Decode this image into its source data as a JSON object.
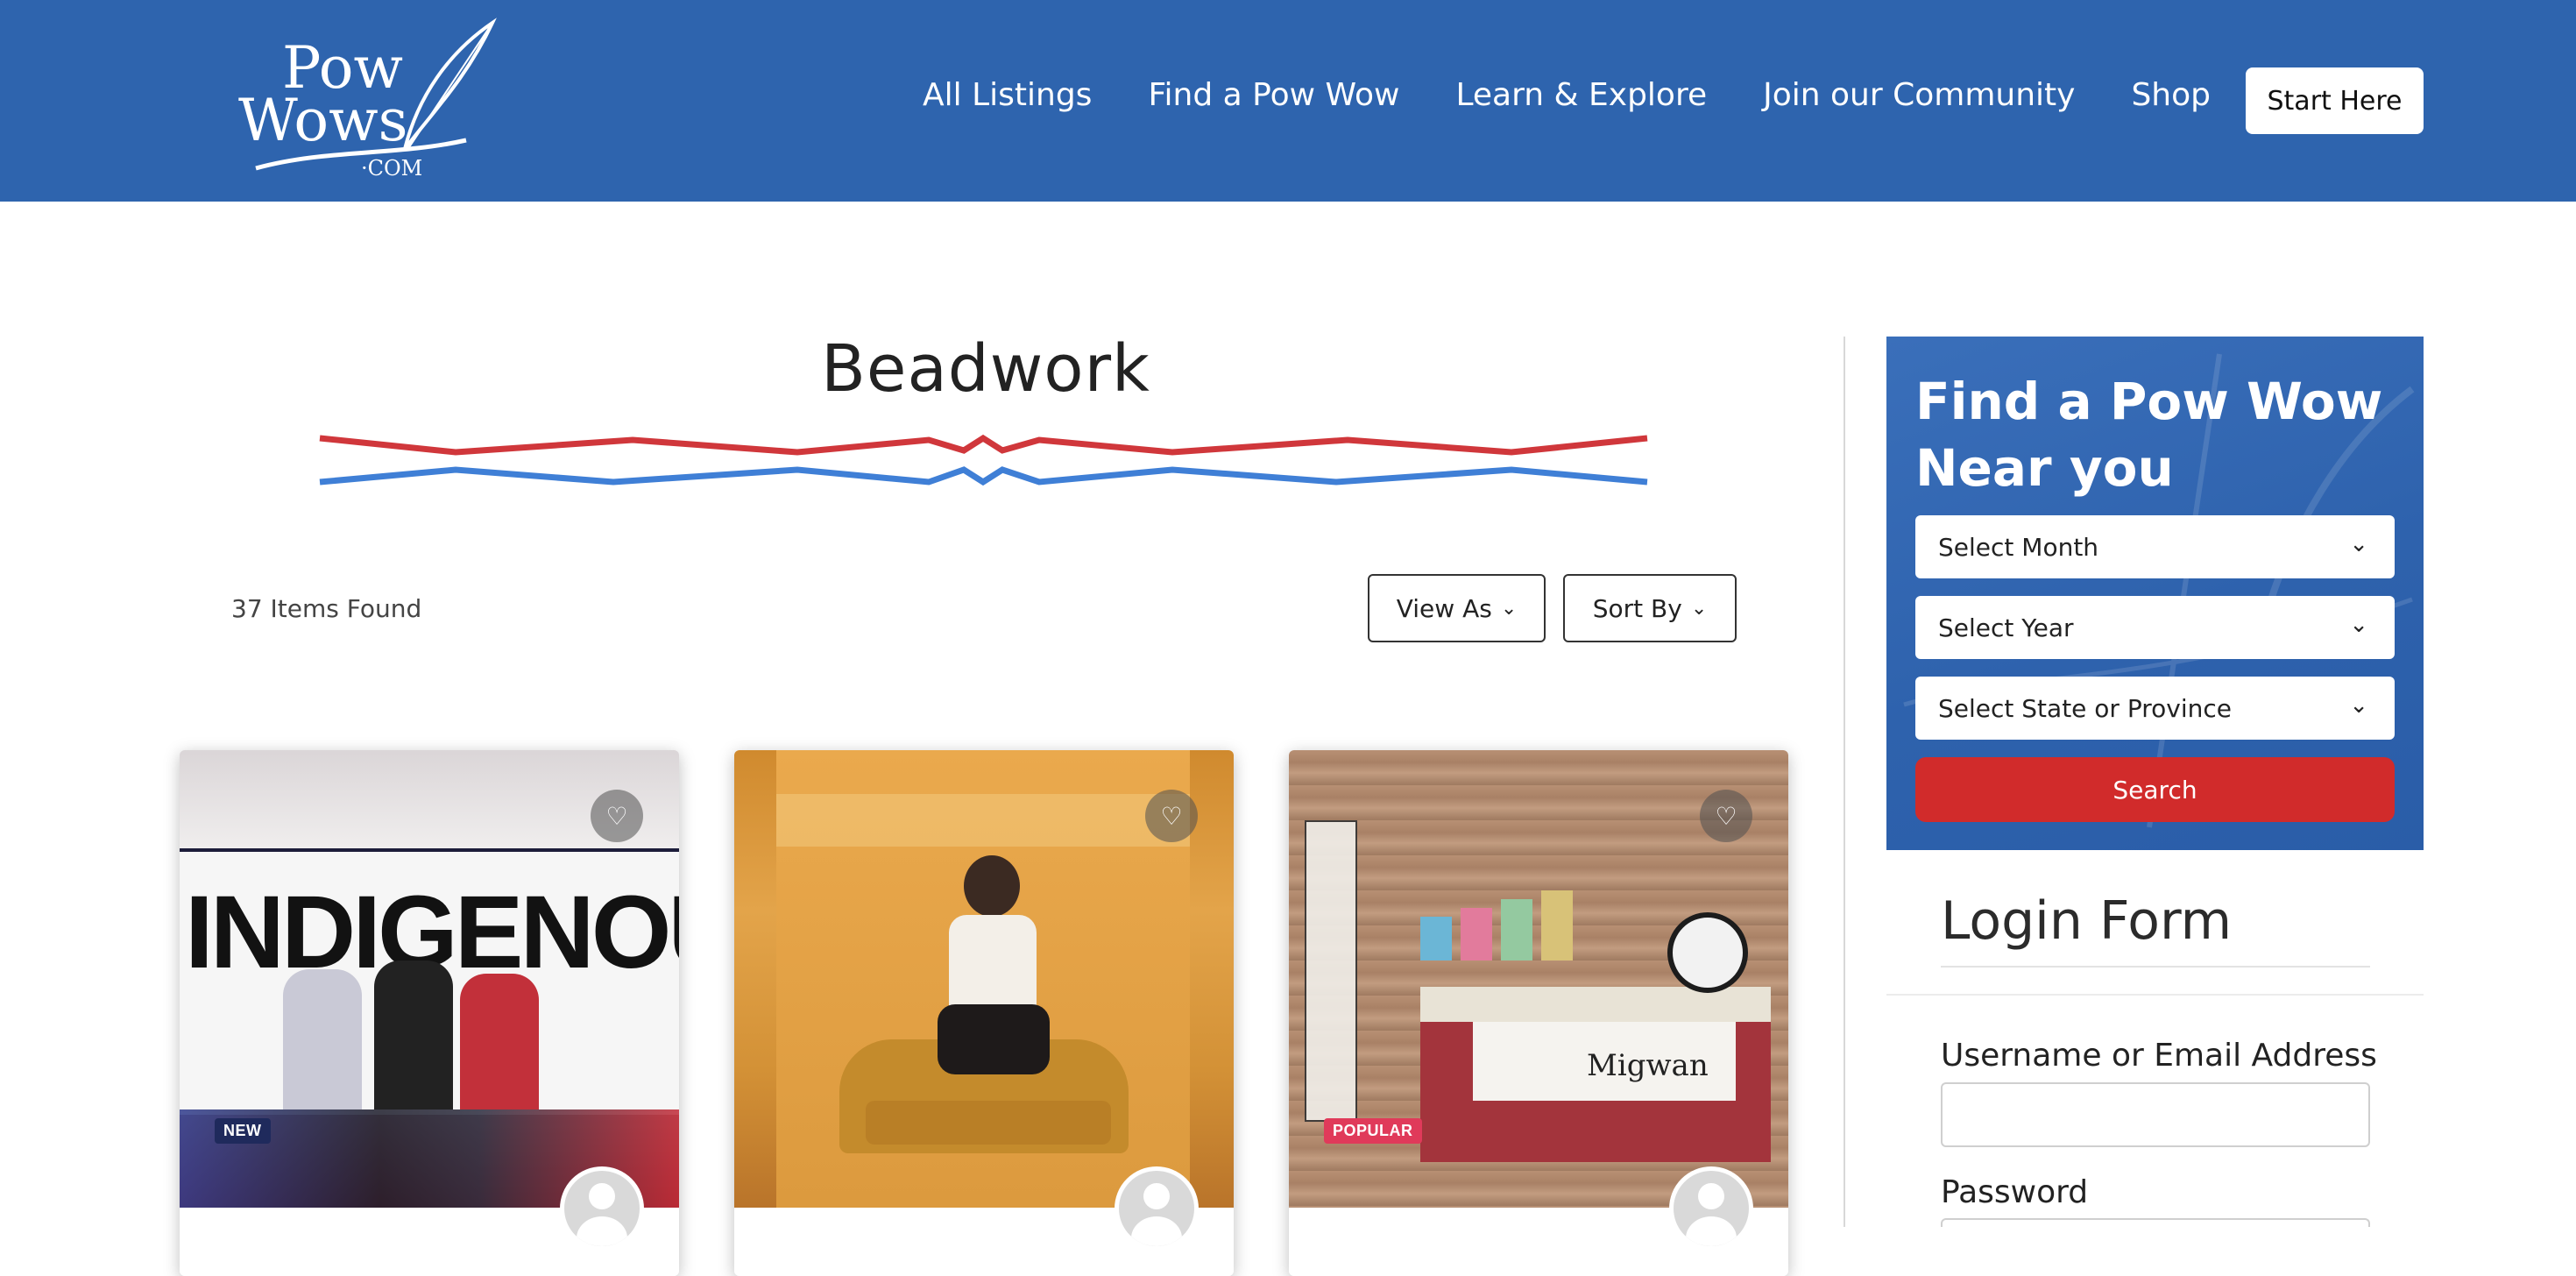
{
  "header": {
    "logo": {
      "line1": "Pow",
      "line2": "Wows",
      "line3": "·COM"
    },
    "nav": [
      "All Listings",
      "Find a Pow Wow",
      "Learn & Explore",
      "Join our Community",
      "Shop"
    ],
    "start_label": "Start Here"
  },
  "main": {
    "title": "Beadwork",
    "items_found": "37 Items Found",
    "view_as_label": "View As",
    "sort_by_label": "Sort By",
    "cards": [
      {
        "badge": "NEW",
        "badge_color": "#1f2a5c",
        "image_text": "INDIGENOUS"
      },
      {
        "badge": "",
        "badge_color": ""
      },
      {
        "badge": "POPULAR",
        "badge_color": "#e03a5a",
        "image_text": "Migwan"
      }
    ]
  },
  "sidebar": {
    "find_title": "Find a Pow Wow Near you",
    "month_label": "Select Month",
    "year_label": "Select Year",
    "state_label": "Select State or Province",
    "search_label": "Search",
    "login_title": "Login Form",
    "username_label": "Username or Email Address",
    "password_label": "Password"
  },
  "colors": {
    "header_bg": "#2e64ae",
    "search_button": "#d12b2b",
    "divider_red": "#d0373b",
    "divider_blue": "#3f7fd6"
  },
  "icons": [
    "heart-icon",
    "chevron-down-icon",
    "avatar-placeholder-icon",
    "feather-logo-icon"
  ]
}
